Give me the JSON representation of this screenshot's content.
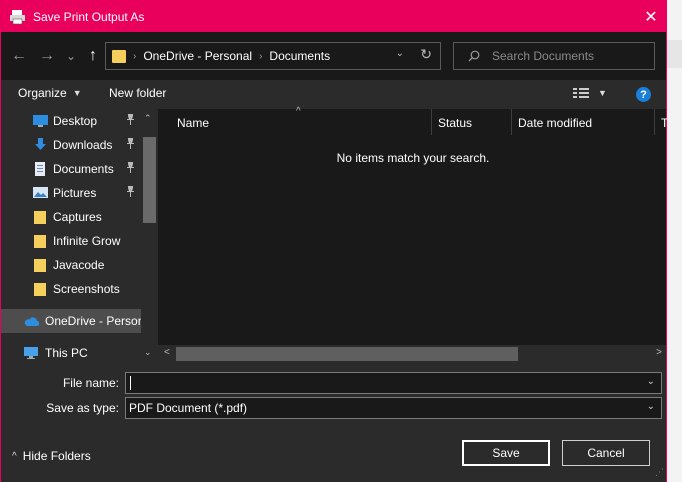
{
  "window": {
    "title": "Save Print Output As",
    "accent_color": "#e8005c",
    "close_glyph": "✕"
  },
  "nav": {
    "back_glyph": "←",
    "forward_glyph": "→",
    "recent_glyph": "⌄",
    "up_glyph": "↑",
    "breadcrumb": [
      "OneDrive - Personal",
      "Documents"
    ],
    "crumb_separator": "›",
    "dropdown_glyph": "⌄",
    "refresh_glyph": "↻",
    "search_placeholder": "Search Documents"
  },
  "toolbar": {
    "organize_label": "Organize",
    "new_folder_label": "New folder",
    "caret_glyph": "▼",
    "help_glyph": "?"
  },
  "navpane": {
    "items": [
      {
        "label": "Desktop",
        "icon": "desktop-icon",
        "pinned": true
      },
      {
        "label": "Downloads",
        "icon": "download-icon",
        "pinned": true
      },
      {
        "label": "Documents",
        "icon": "document-icon",
        "pinned": true
      },
      {
        "label": "Pictures",
        "icon": "pictures-icon",
        "pinned": true
      },
      {
        "label": "Captures",
        "icon": "folder-icon",
        "pinned": false
      },
      {
        "label": "Infinite Grow",
        "icon": "folder-icon",
        "pinned": false
      },
      {
        "label": "Javacode",
        "icon": "folder-icon",
        "pinned": false
      },
      {
        "label": "Screenshots",
        "icon": "folder-icon",
        "pinned": false
      }
    ],
    "onedrive_label": "OneDrive - Person",
    "thispc_label": "This PC",
    "pin_glyph": "📌",
    "scroll_up_glyph": "⌃",
    "scroll_down_glyph": "⌄"
  },
  "filelist": {
    "columns": [
      "Name",
      "Status",
      "Date modified",
      "T"
    ],
    "sort_glyph": "^",
    "empty_message": "No items match your search.",
    "scroll_left_glyph": "<",
    "scroll_right_glyph": ">"
  },
  "form": {
    "file_name_label": "File name:",
    "file_name_value": "",
    "save_type_label": "Save as type:",
    "save_type_value": "PDF Document (*.pdf)",
    "dropdown_glyph": "⌄"
  },
  "footer": {
    "hide_folders_label": "Hide Folders",
    "hide_glyph": "^",
    "save_label": "Save",
    "cancel_label": "Cancel",
    "grip_glyph": "⋰"
  }
}
